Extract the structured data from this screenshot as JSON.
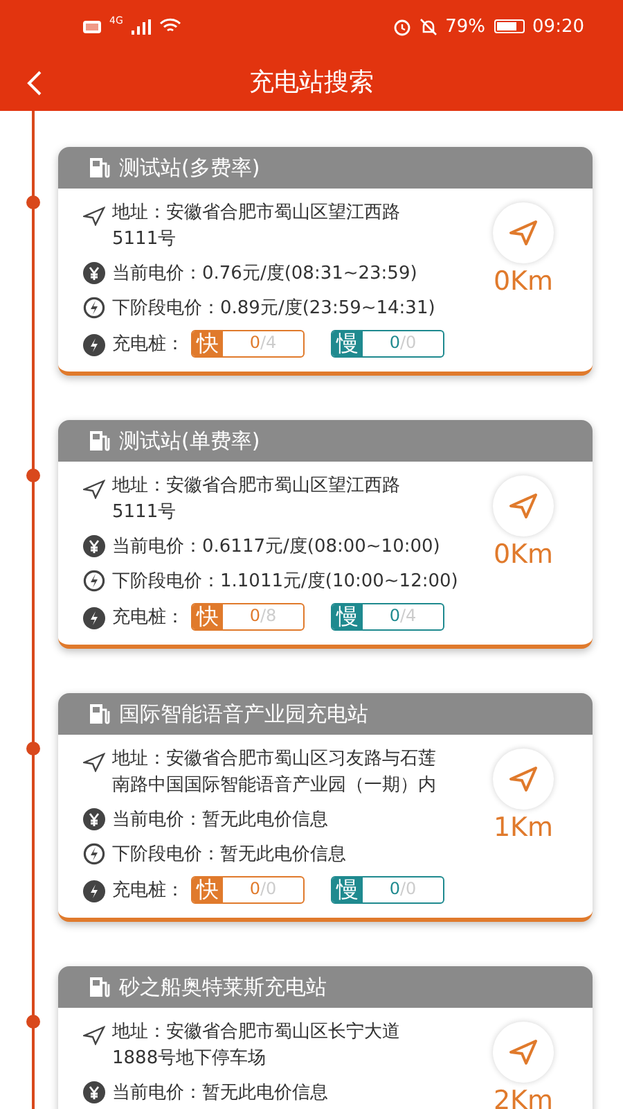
{
  "status_bar": {
    "network": "4G",
    "battery_text": "79%",
    "time": "09:20"
  },
  "title_bar": {
    "title": "充电站搜索"
  },
  "stations": [
    {
      "name": "测试站(多费率)",
      "address": "地址：安徽省合肥市蜀山区望江西路5111号",
      "current_price": "当前电价：0.76元/度(08:31~23:59)",
      "next_price": "下阶段电价：0.89元/度(23:59~14:31)",
      "piles_label": "充电桩：",
      "fast": {
        "label": "快",
        "count": "0",
        "total": "/4"
      },
      "slow": {
        "label": "慢",
        "count": "0",
        "total": "/0"
      },
      "distance": "0Km"
    },
    {
      "name": "测试站(单费率)",
      "address": "地址：安徽省合肥市蜀山区望江西路5111号",
      "current_price": "当前电价：0.6117元/度(08:00~10:00)",
      "next_price": "下阶段电价：1.1011元/度(10:00~12:00)",
      "piles_label": "充电桩：",
      "fast": {
        "label": "快",
        "count": "0",
        "total": "/8"
      },
      "slow": {
        "label": "慢",
        "count": "0",
        "total": "/4"
      },
      "distance": "0Km"
    },
    {
      "name": "国际智能语音产业园充电站",
      "address": "地址：安徽省合肥市蜀山区习友路与石莲南路中国国际智能语音产业园（一期）内",
      "current_price": "当前电价：暂无此电价信息",
      "next_price": "下阶段电价：暂无此电价信息",
      "piles_label": "充电桩：",
      "fast": {
        "label": "快",
        "count": "0",
        "total": "/0"
      },
      "slow": {
        "label": "慢",
        "count": "0",
        "total": "/0"
      },
      "distance": "1Km"
    },
    {
      "name": "砂之船奥特莱斯充电站",
      "address": "地址：安徽省合肥市蜀山区长宁大道1888号地下停车场",
      "current_price": "当前电价：暂无此电价信息",
      "distance": "2Km"
    }
  ]
}
